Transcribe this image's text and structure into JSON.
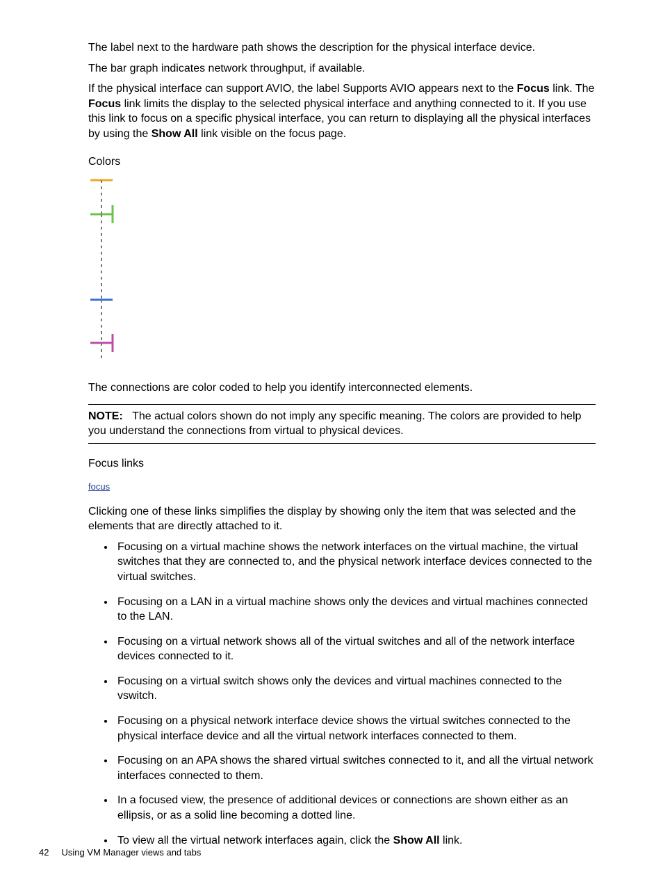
{
  "para1": "The label next to the hardware path shows the description for the physical interface device.",
  "para2": "The bar graph indicates network throughput, if available.",
  "para3_a": "If the physical interface can support AVIO, the label Supports AVIO appears next to the ",
  "para3_focus1": "Focus",
  "para3_b": " link. The ",
  "para3_focus2": "Focus",
  "para3_c": " link limits the display to the selected physical interface and anything connected to it. If you use this link to focus on a specific physical interface, you can return to displaying all the physical interfaces by using the ",
  "para3_showall": "Show All",
  "para3_d": " link visible on the focus page.",
  "heading_colors": "Colors",
  "para_colors": "The connections are color coded to help you identify interconnected elements.",
  "note_label": "NOTE:",
  "note_text": "The actual colors shown do not imply any specific meaning. The colors are provided to help you understand the connections from virtual to physical devices.",
  "heading_focus": "Focus links",
  "focus_link_text": "focus",
  "para_focus_intro": "Clicking one of these links simplifies the display by showing only the item that was selected and the elements that are directly attached to it.",
  "bullets": [
    "Focusing on a virtual machine shows the network interfaces on the virtual machine, the virtual switches that they are connected to, and the physical network interface devices connected to the virtual switches.",
    "Focusing on a LAN in a virtual machine shows only the devices and virtual machines connected to the LAN.",
    "Focusing on a virtual network shows all of the virtual switches and all of the network interface devices connected to it.",
    "Focusing on a virtual switch shows only the devices and virtual machines connected to the vswitch.",
    "Focusing on a physical network interface device shows the virtual switches connected to the physical interface device and all the virtual network interfaces connected to them.",
    "Focusing on an APA shows the shared virtual switches connected to it, and all the virtual network interfaces connected to them.",
    "In a focused view, the presence of additional devices or connections are shown either as an ellipsis, or as a solid line becoming a dotted line."
  ],
  "bullet_last_a": "To view all the virtual network interfaces again, click the ",
  "bullet_last_showall": "Show All",
  "bullet_last_b": " link.",
  "footer_page": "42",
  "footer_text": "Using VM Manager views and tabs"
}
